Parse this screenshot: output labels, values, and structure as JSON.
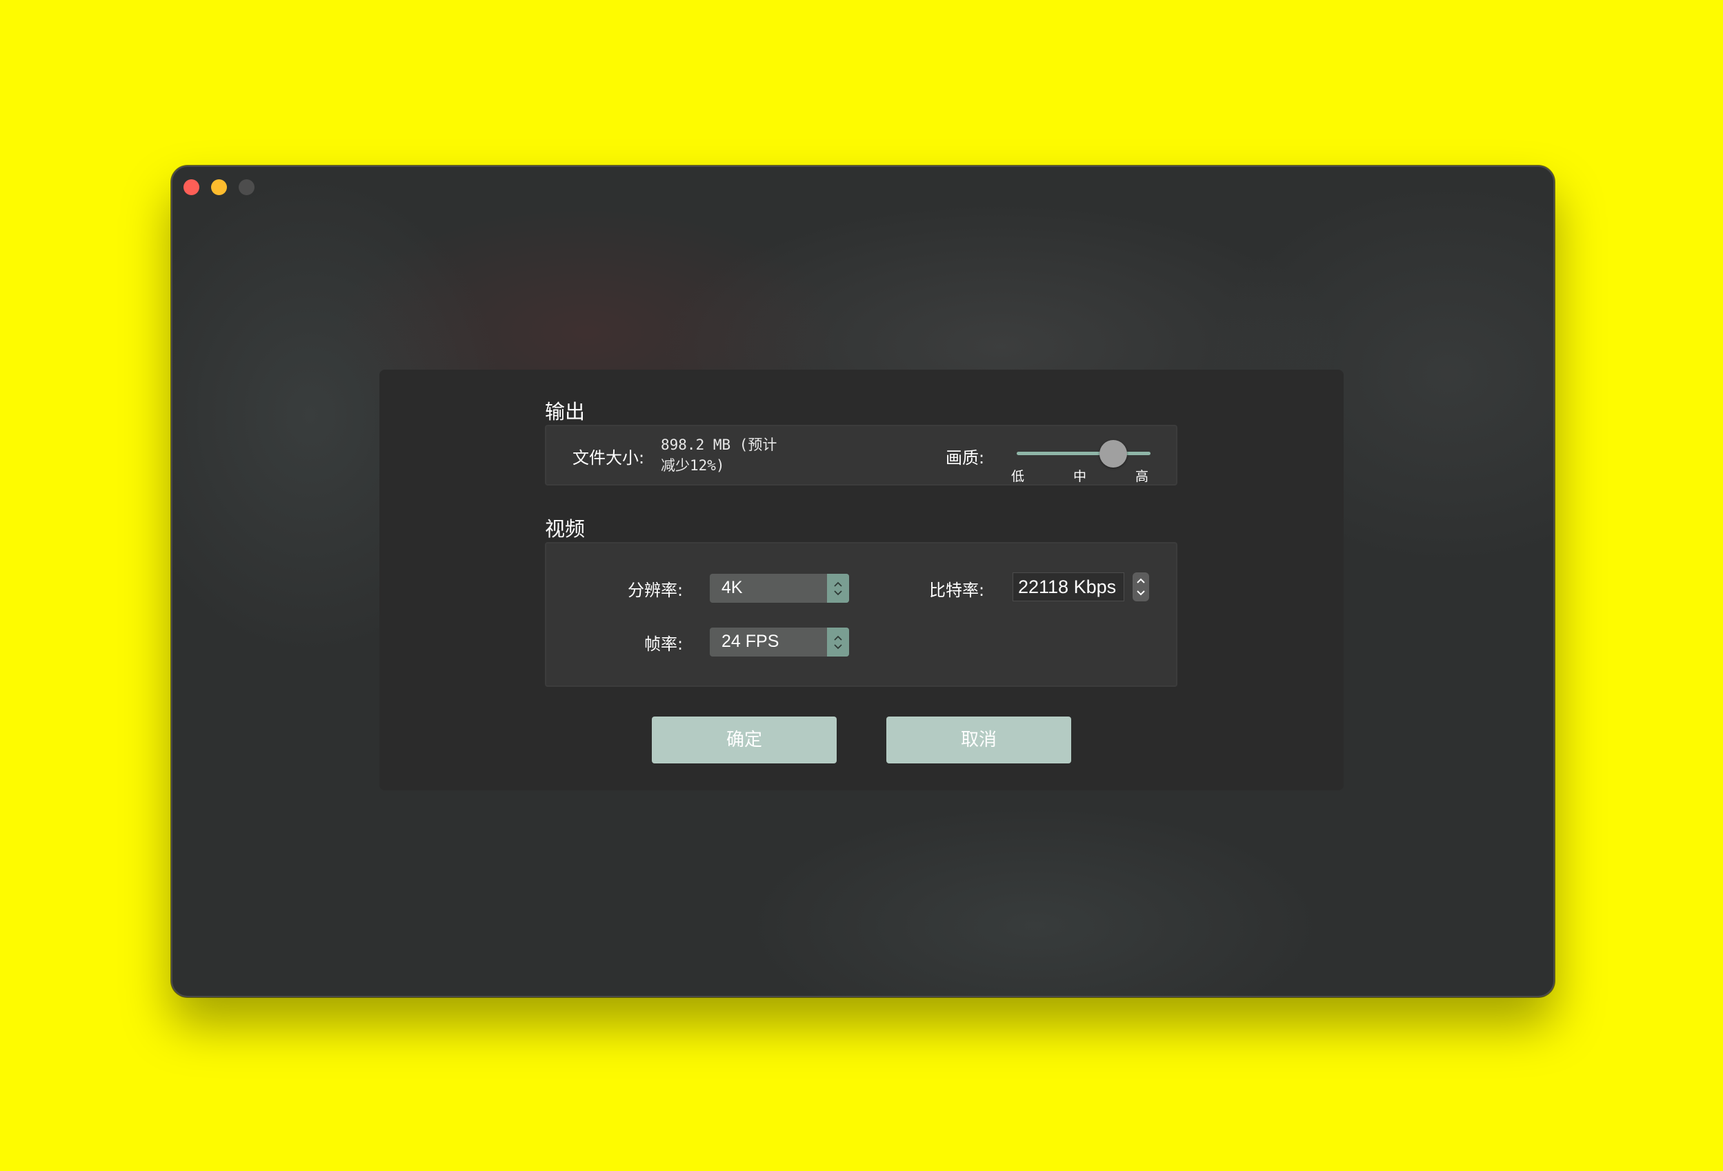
{
  "window": {
    "controls": [
      "close",
      "minimize",
      "zoom"
    ]
  },
  "output": {
    "title": "输出",
    "file_size_label": "文件大小:",
    "file_size_value_line1": "898.2 MB (预计",
    "file_size_value_line2": "减少12%)",
    "quality_label": "画质:",
    "quality_level": 0.72,
    "quality_ticks": [
      "低",
      "中",
      "高"
    ]
  },
  "video": {
    "title": "视频",
    "resolution_label": "分辨率:",
    "resolution_value": "4K",
    "bitrate_label": "比特率:",
    "bitrate_value": "22118 Kbps",
    "framerate_label": "帧率:",
    "framerate_value": "24 FPS"
  },
  "buttons": {
    "confirm_label": "确定",
    "cancel_label": "取消"
  },
  "colors": {
    "background": "#fefb00",
    "window": "#2e3030",
    "panel": "#2b2b2b",
    "accent": "#8fb6a8",
    "button": "#b4cbc3"
  },
  "icons": {
    "stepper": "chevron-up-down-icon"
  }
}
